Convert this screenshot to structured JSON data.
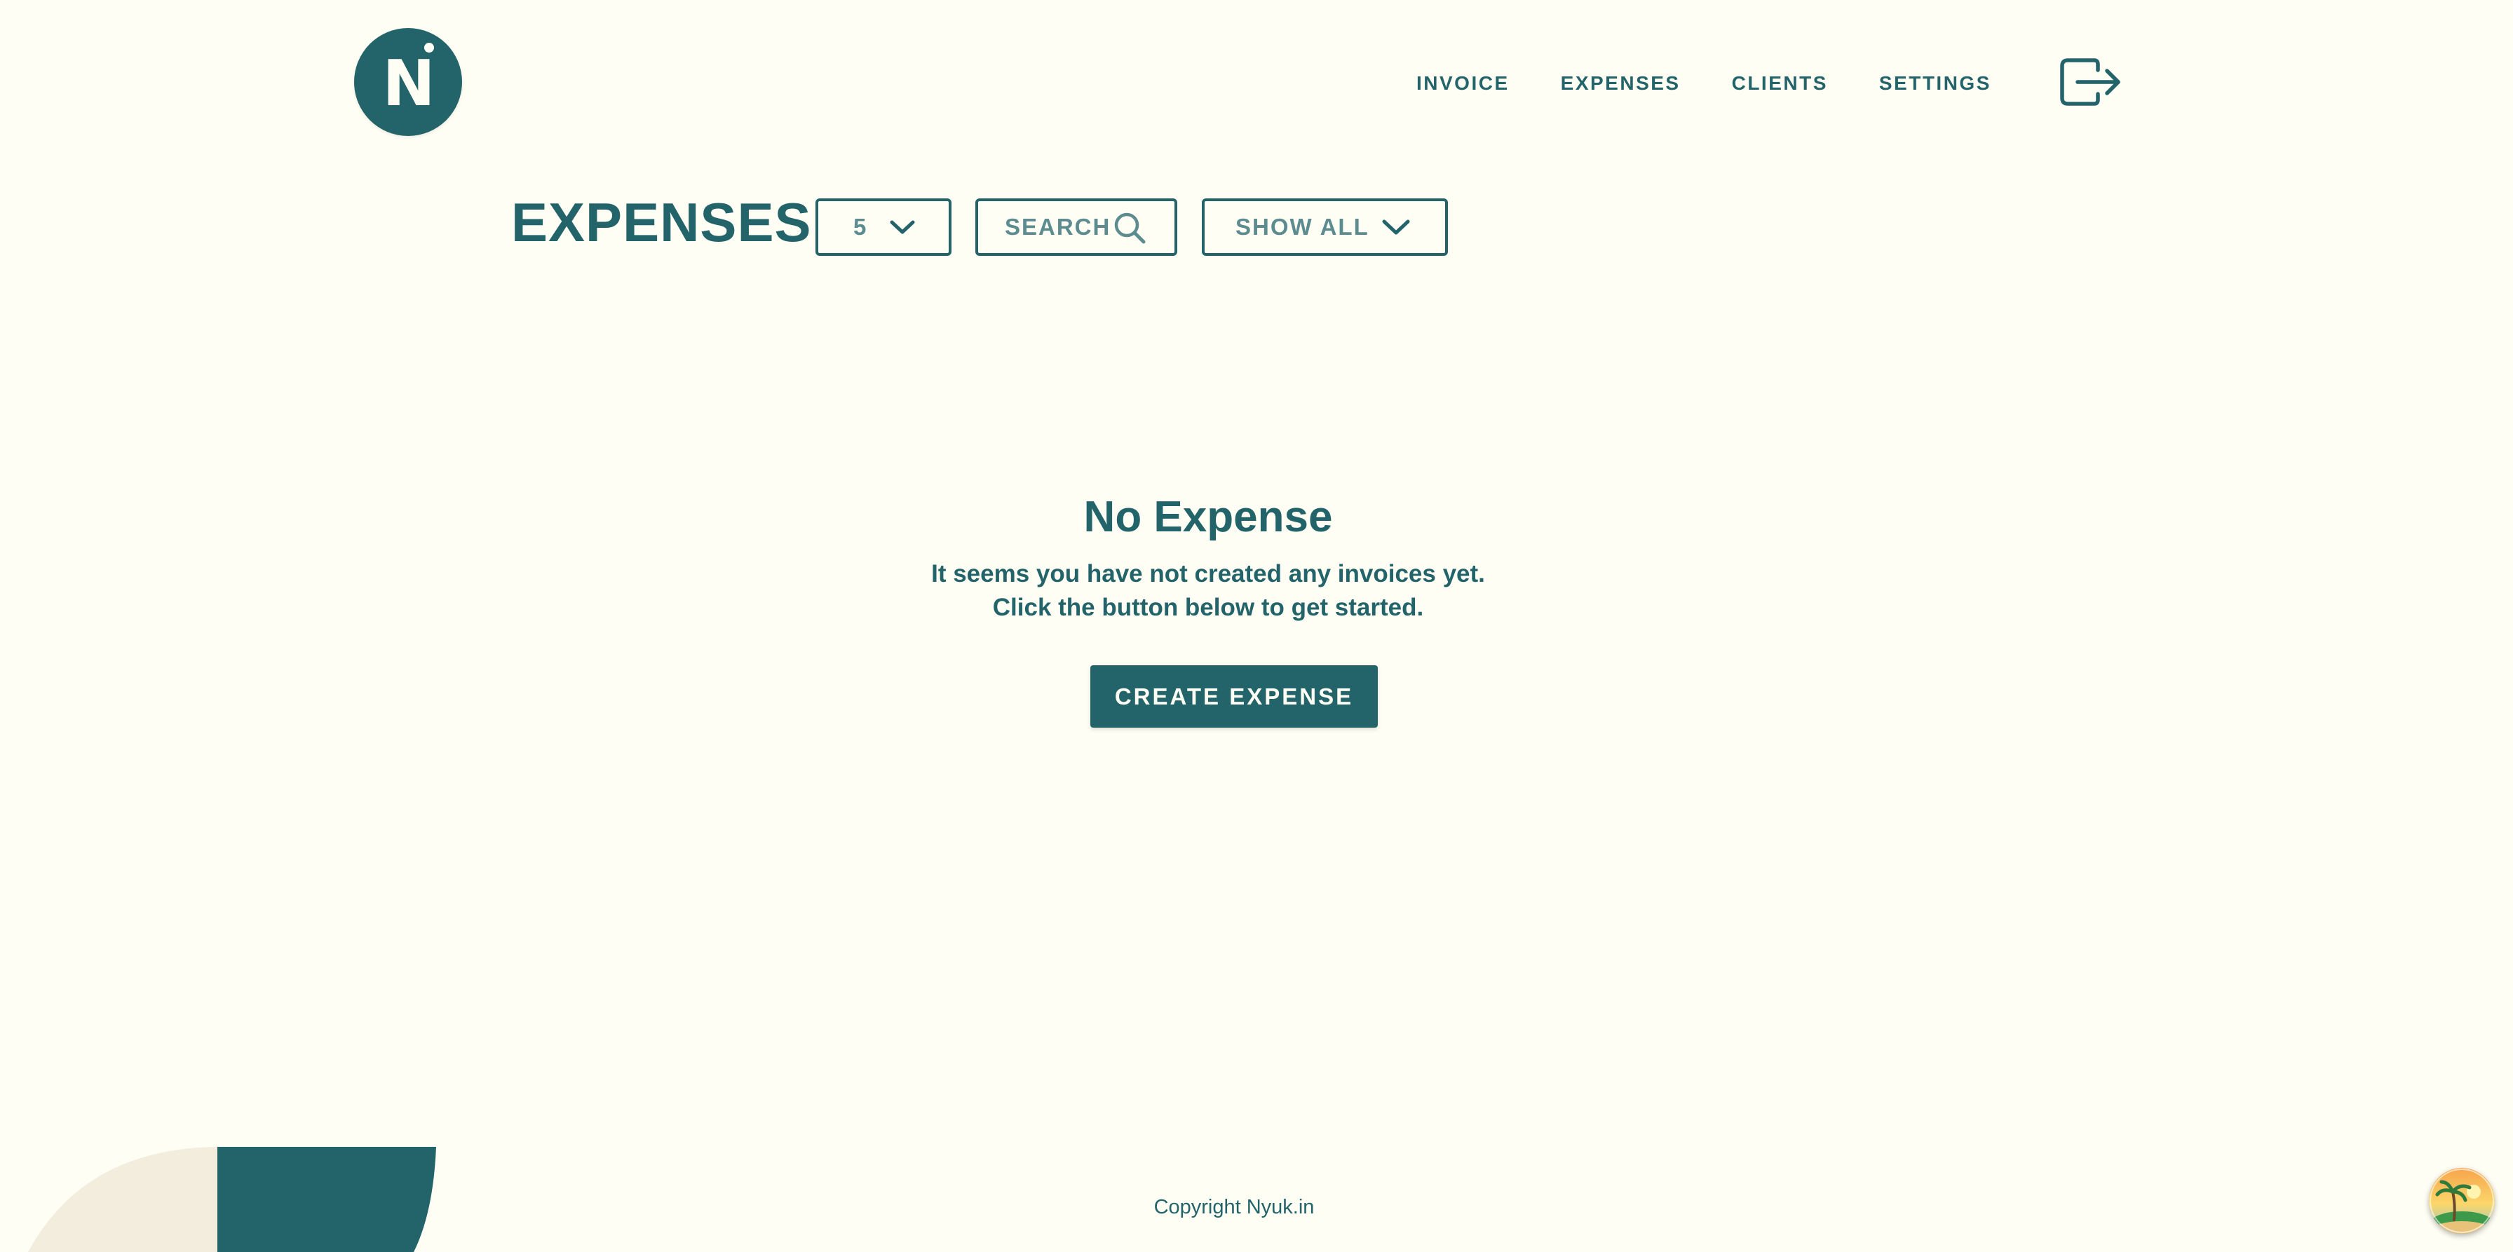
{
  "brand": {
    "logo_text": "N",
    "accent_color": "#23646A",
    "background_color": "#FFFEF4"
  },
  "nav": {
    "items": [
      {
        "label": "INVOICE"
      },
      {
        "label": "EXPENSES"
      },
      {
        "label": "CLIENTS"
      },
      {
        "label": "SETTINGS"
      }
    ],
    "logout_icon": "logout-icon"
  },
  "toolbar": {
    "title": "EXPENSES",
    "per_page": {
      "value": "5",
      "icon": "chevron-down-icon"
    },
    "search": {
      "label": "SEARCH",
      "icon": "search-icon"
    },
    "filter": {
      "value": "SHOW ALL",
      "icon": "chevron-down-icon"
    }
  },
  "empty_state": {
    "title": "No Expense",
    "line1": "It seems you have not created any invoices yet.",
    "line2": "Click the button below to get started.",
    "button_label": "CREATE EXPENSE"
  },
  "footer": {
    "copyright": "Copyright Nyuk.in"
  }
}
